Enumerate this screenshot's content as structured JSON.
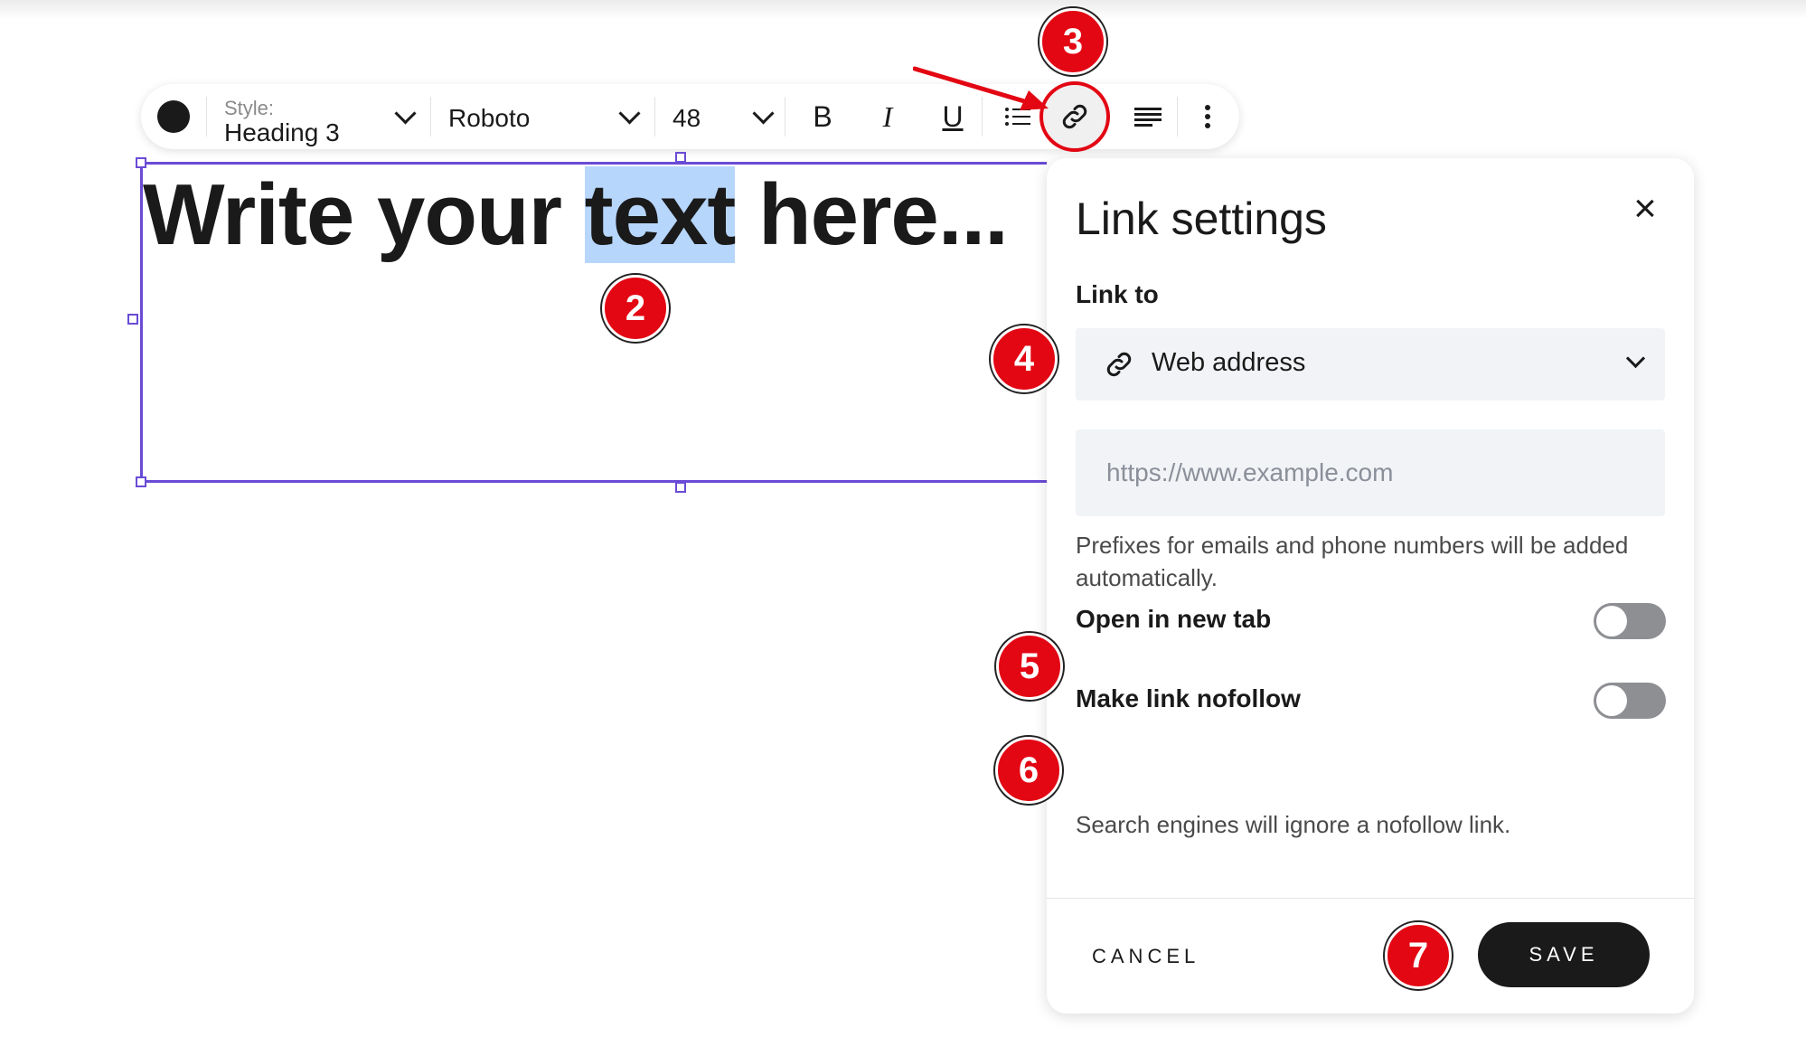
{
  "toolbar": {
    "style_label": "Style:",
    "style_value": "Heading 3",
    "font_value": "Roboto",
    "size_value": "48",
    "bold_label": "B",
    "italic_label": "I",
    "underline_label": "U",
    "text_color": "#1a1a1a",
    "icons": [
      "color-swatch-icon",
      "bold-icon",
      "italic-icon",
      "underline-icon",
      "list-icon",
      "link-icon",
      "align-icon",
      "more-icon"
    ]
  },
  "canvas": {
    "text_before": "Write your ",
    "text_selected": "text",
    "text_after": " here...",
    "selection_color": "#b7d6fb",
    "frame_color": "#6a4bd6"
  },
  "link_panel": {
    "title": "Link settings",
    "link_to_label": "Link to",
    "link_type": "Web address",
    "url_placeholder": "https://www.example.com",
    "url_value": "",
    "prefix_hint": "Prefixes for emails and phone numbers will be added automatically.",
    "new_tab_label": "Open in new tab",
    "new_tab_on": false,
    "nofollow_label": "Make link nofollow",
    "nofollow_on": false,
    "nofollow_hint": "Search engines will ignore a nofollow link.",
    "cancel_label": "CANCEL",
    "save_label": "SAVE"
  },
  "annotations": {
    "marker_color": "#e30613",
    "markers": [
      "2",
      "3",
      "4",
      "5",
      "6",
      "7"
    ]
  }
}
